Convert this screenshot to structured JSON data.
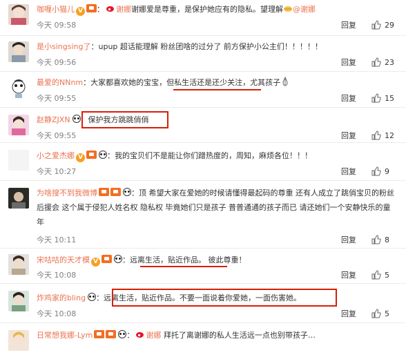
{
  "reply_label": "回复",
  "comments": [
    {
      "user": "咖喱小猫儿",
      "text_a": "谢娜爱是尊重，是保护她应有的隐私。望理解",
      "mention": "@谢娜",
      "time": "今天 09:58",
      "likes": "29"
    },
    {
      "user": "是小singsing了",
      "text_a": "：upup 超话能理解 粉丝团啥的过分了 前方保护小公主们！！！！！",
      "time": "今天 09:56",
      "likes": "23"
    },
    {
      "user": "最爱的NNnm",
      "text_a": "：大家都喜欢她的宝宝，",
      "text_b": "但私生活还是还少关注",
      "text_c": "，尤其孩子",
      "time": "今天 09:55",
      "likes": "15"
    },
    {
      "user": "赵静ZJXN",
      "text_a": "：保护我方跳跳俏俏",
      "time": "今天 09:55",
      "likes": "12"
    },
    {
      "user": "小之爱杰娜",
      "text_a": "：我的宝贝们不是能让你们蹭热度的，周知，麻烦各位！！！",
      "time": "今天 10:27",
      "likes": "9"
    },
    {
      "user": "为啥搜不到我微博",
      "text_a": "：顶 希望大家在爱她的时候请懂得最起码的尊重 还有人成立了跳俏宝贝的粉丝后援会 这个属于侵犯人姓名权 隐私权 毕竟她们只是孩子 普普通通的孩子而已 请还她们一个安静快乐的童年",
      "time": "今天 10:11",
      "likes": "8"
    },
    {
      "user": "宋咕咕的天才模",
      "text_a": "：",
      "text_b": "远离生活，贴近作品。",
      "text_c": " 彼此尊重！",
      "time": "今天 10:08",
      "likes": "5"
    },
    {
      "user": "炸鸡家的bling",
      "text_a": "：远离生活，贴近作品。不要一面说着你爱她，一面伤害她。",
      "time": "今天 10:08",
      "likes": "5"
    },
    {
      "user": "日常想我娜-Lym",
      "text_a": "谢娜",
      "text_b": "拜托了离谢娜的私人生活远一点也别带孩子…",
      "time": "",
      "likes": ""
    }
  ],
  "colors": {
    "username": "#eb7350",
    "highlight": "#d81e06",
    "meta": "#808080"
  }
}
